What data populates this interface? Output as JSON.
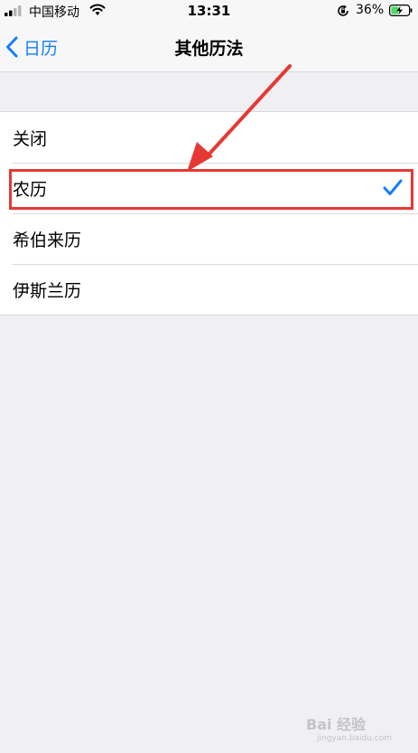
{
  "status_bar": {
    "carrier": "中国移动",
    "time": "13:31",
    "battery_percent": "36%"
  },
  "nav": {
    "back_label": "日历",
    "title": "其他历法"
  },
  "options": [
    {
      "label": "关闭",
      "selected": false
    },
    {
      "label": "农历",
      "selected": true
    },
    {
      "label": "希伯来历",
      "selected": false
    },
    {
      "label": "伊斯兰历",
      "selected": false
    }
  ],
  "colors": {
    "accent": "#147efb",
    "annotation": "#e53935",
    "background": "#efeff4"
  },
  "watermark": {
    "text": "Bai 经验",
    "url": "jingyan.baidu.com"
  }
}
